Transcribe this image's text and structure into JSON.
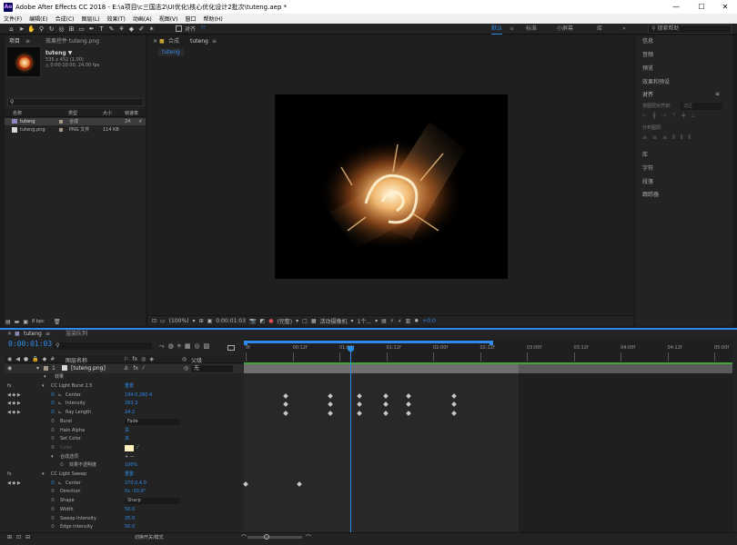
{
  "window": {
    "title": "Adobe After Effects CC 2018 - E:\\a项目\\c三国志2\\UI优化\\核心优化设计2批次\\tuteng.aep *",
    "minimize": "—",
    "maximize": "☐",
    "close": "✕"
  },
  "menu": [
    "文件(F)",
    "编辑(E)",
    "合成(C)",
    "图层(L)",
    "效果(T)",
    "动画(A)",
    "视图(V)",
    "窗口",
    "帮助(H)"
  ],
  "toolbar": {
    "snap_label": "对齐",
    "workspaces": [
      "默认",
      "标准",
      "小屏幕",
      "库"
    ],
    "active_workspace": "默认",
    "search_placeholder": "搜索帮助"
  },
  "project_panel": {
    "tab_project": "项目",
    "tab_effects": "效果控件 tuteng.png",
    "item_name": "tuteng ▼",
    "item_info1": "535 x 452 (1.00)",
    "item_info2": "△ 0:00:10:00, 24.00 fps",
    "search_placeholder": "",
    "columns": {
      "name": "名称",
      "type": "类型",
      "size": "大小",
      "fps": "帧速率"
    },
    "rows": [
      {
        "name": "tuteng",
        "type": "合成",
        "size": "",
        "fps": "24"
      },
      {
        "name": "tuteng.png",
        "type": "PNG 文件",
        "size": "114 KB",
        "fps": ""
      }
    ],
    "bpc": "8 bpc"
  },
  "composition_panel": {
    "tab_label": "合成",
    "tab_name": "tuteng",
    "breadcrumb": "tuteng",
    "footer": {
      "zoom": "(100%)",
      "timecode": "0:00:01:03",
      "quality": "(完整)",
      "camera": "活动摄像机",
      "views": "1个...",
      "exposure": "+0.0"
    }
  },
  "right_panel": {
    "items": [
      "信息",
      "音频",
      "预览",
      "效果和预设"
    ],
    "align_title": "对齐",
    "align_to_label": "将图层对齐到:",
    "align_to_value": "选区",
    "distribute_label": "分布图层:",
    "items2": [
      "库",
      "字符",
      "段落",
      "跟踪器"
    ]
  },
  "timeline": {
    "tab_comp": "tuteng",
    "tab_render": "渲染队列",
    "current_time": "0:00:01:03",
    "search_placeholder": "",
    "col_layer_name": "图层名称",
    "col_mode": "父级",
    "layer": {
      "index": "1",
      "name": "[tuteng.png]",
      "parent": "无"
    },
    "effects_label": "效果",
    "rows": [
      {
        "indent": 1,
        "name": "CC Light Burst 2.5",
        "value": "重置",
        "type": "effect"
      },
      {
        "indent": 2,
        "name": "Center",
        "value": "194.0,260.4",
        "type": "prop",
        "kf": true
      },
      {
        "indent": 2,
        "name": "Intensity",
        "value": "283.3",
        "type": "prop",
        "kf": true
      },
      {
        "indent": 2,
        "name": "Ray Length",
        "value": "24.2",
        "type": "prop",
        "kf": true
      },
      {
        "indent": 2,
        "name": "Burst",
        "value": "Fade",
        "type": "dropdown"
      },
      {
        "indent": 2,
        "name": "Halo Alpha",
        "value": "关",
        "type": "prop"
      },
      {
        "indent": 2,
        "name": "Set Color",
        "value": "关",
        "type": "prop"
      },
      {
        "indent": 2,
        "name": "Color",
        "value": "",
        "type": "color"
      },
      {
        "indent": 2,
        "name": "合成选项",
        "value": "+ —",
        "type": "group"
      },
      {
        "indent": 3,
        "name": "效果不透明度",
        "value": "100%",
        "type": "prop"
      },
      {
        "indent": 1,
        "name": "CC Light Sweep",
        "value": "重置",
        "type": "effect"
      },
      {
        "indent": 2,
        "name": "Center",
        "value": "270.0,4.0",
        "type": "prop",
        "kf": true
      },
      {
        "indent": 2,
        "name": "Direction",
        "value": "0x -30.0°",
        "type": "prop"
      },
      {
        "indent": 2,
        "name": "Shape",
        "value": "Sharp",
        "type": "dropdown"
      },
      {
        "indent": 2,
        "name": "Width",
        "value": "50.0",
        "type": "prop"
      },
      {
        "indent": 2,
        "name": "Sweep Intensity",
        "value": "25.0",
        "type": "prop"
      },
      {
        "indent": 2,
        "name": "Edge Intensity",
        "value": "50.0",
        "type": "prop"
      }
    ],
    "ruler": [
      "0f",
      "00:12f",
      "01:00f",
      "01:12f",
      "02:00f",
      "02:12f",
      "03:00f",
      "03:12f",
      "04:00f",
      "04:12f",
      "05:00f"
    ],
    "footer_label": "切换开关/模式"
  },
  "colors": {
    "accent": "#2d8ceb",
    "set_color_swatch": "#fff0c0",
    "timeline_green": "#3fa33f"
  }
}
